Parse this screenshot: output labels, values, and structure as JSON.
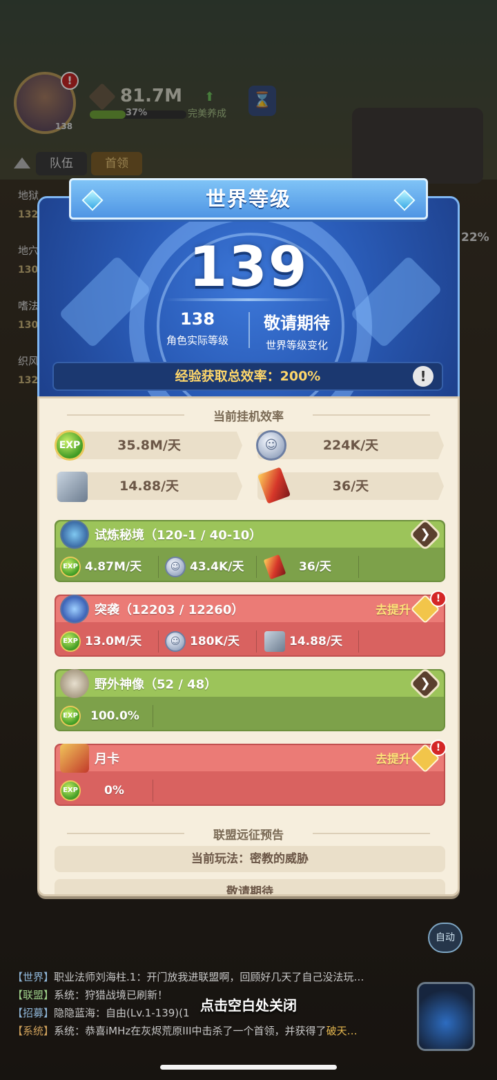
{
  "background": {
    "avatar_level": "138",
    "avatar_badge": "!",
    "power_value": "81.7M",
    "power_percent": "37%",
    "power_fraction": 0.37,
    "nurture_label": "完美养成",
    "tabs": [
      "队伍",
      "首领"
    ],
    "side_items": [
      {
        "label": "地狱",
        "num": "132"
      },
      {
        "label": "地穴",
        "num": "130"
      },
      {
        "label": "嗜法",
        "num": "130"
      },
      {
        "label": "织风",
        "num": "132"
      }
    ],
    "right_percent": "22%",
    "auto_label": "自动",
    "close_hint": "点击空白处关闭",
    "chat": [
      {
        "channel": "【世界】",
        "text": "职业法师刘海柱.1：开门放我进联盟啊，回顾好几天了自己没法玩…",
        "highlight": ""
      },
      {
        "channel": "【联盟】",
        "text": "系统：狩猎战境已刷新！",
        "highlight": ""
      },
      {
        "channel": "【招募】",
        "text": "隐隐蓝海：自由(Lv.1-139)(1",
        "highlight": ""
      },
      {
        "channel": "【系统】",
        "text": "系统：恭喜iMHz在灰烬荒原III中击杀了一个首领，并获得了",
        "highlight": "破天…"
      }
    ]
  },
  "popup": {
    "title": "世界等级",
    "world_level": "139",
    "actual_level_value": "138",
    "actual_level_label": "角色实际等级",
    "world_change_value": "敬请期待",
    "world_change_label": "世界等级变化",
    "efficiency_text": "经验获取总效率：200%",
    "efficiency_icon": "!",
    "current_rate_title": "当前挂机效率",
    "rates": [
      {
        "icon": "exp-icon",
        "icon_text": "EXP",
        "value": "35.8M/天"
      },
      {
        "icon": "coin-icon",
        "icon_text": "☺",
        "value": "224K/天"
      },
      {
        "icon": "ore-icon",
        "icon_text": "",
        "value": "14.88/天"
      },
      {
        "icon": "crystal-icon",
        "icon_text": "",
        "value": "36/天"
      }
    ],
    "cards": [
      {
        "title": "试炼秘境（120-1 / 40-10）",
        "color": "#7da14a",
        "action": "",
        "cells": [
          {
            "icon": "exp",
            "icon_text": "EXP",
            "value": "4.87M/天"
          },
          {
            "icon": "coin",
            "icon_text": "☺",
            "value": "43.4K/天"
          },
          {
            "icon": "crystal",
            "icon_text": "",
            "value": "36/天"
          }
        ]
      },
      {
        "title": "突袭（12203 / 12260）",
        "color": "#d96260",
        "action": "去提升",
        "cells": [
          {
            "icon": "exp",
            "icon_text": "EXP",
            "value": "13.0M/天"
          },
          {
            "icon": "coin",
            "icon_text": "☺",
            "value": "180K/天"
          },
          {
            "icon": "ore",
            "icon_text": "",
            "value": "14.88/天"
          }
        ]
      },
      {
        "title": "野外神像（52 / 48）",
        "color": "#7da14a",
        "action": "",
        "cells": [
          {
            "icon": "exp",
            "icon_text": "EXP",
            "value": "100.0%"
          }
        ]
      },
      {
        "title": "月卡",
        "color": "#d96260",
        "action": "去提升",
        "cells": [
          {
            "icon": "exp",
            "icon_text": "EXP",
            "value": "0%"
          }
        ]
      }
    ],
    "alert_mark": "!",
    "arrow_glyph": "❯",
    "alliance_title": "联盟远征预告",
    "alliance_current": "当前玩法：密教的威胁",
    "alliance_next": "敬请期待"
  }
}
